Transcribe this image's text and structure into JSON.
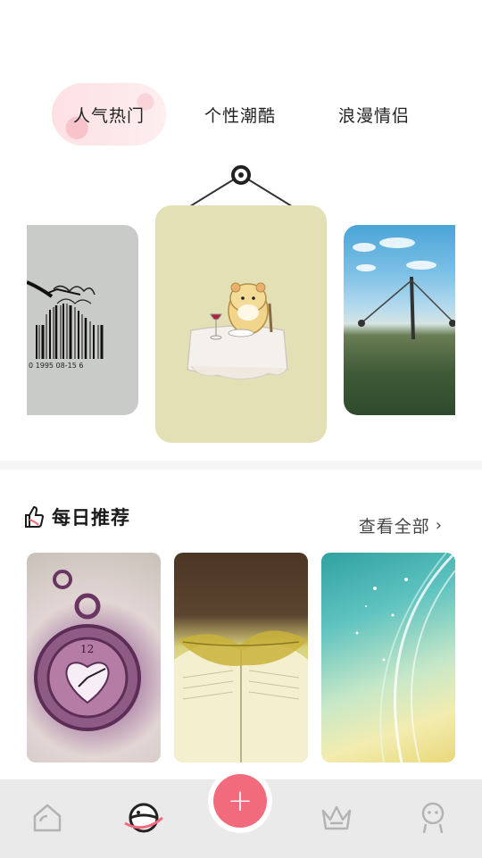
{
  "tabs": [
    {
      "label": "人气热门",
      "active": true
    },
    {
      "label": "个性潮酷",
      "active": false
    },
    {
      "label": "浪漫情侣",
      "active": false
    }
  ],
  "carousel": {
    "cards": [
      {
        "image": "barcode-fork-spaghetti",
        "barcode_text": "0  1995  08-15  6"
      },
      {
        "image": "hamster-dinner-table"
      },
      {
        "image": "landscape-swing-field"
      }
    ]
  },
  "daily": {
    "icon": "thumbs-up-icon",
    "title": "每日推荐",
    "view_all": "查看全部",
    "view_all_chevron": "›",
    "thumbnails": [
      {
        "image": "pocket-watch-flowers"
      },
      {
        "image": "open-book-leaf"
      },
      {
        "image": "teal-light-streaks"
      }
    ]
  },
  "bottom_nav": {
    "items": [
      {
        "icon": "home-icon",
        "active": false
      },
      {
        "icon": "planet-icon",
        "active": true
      },
      {
        "icon": "crown-icon",
        "active": false
      },
      {
        "icon": "profile-icon",
        "active": false
      }
    ],
    "fab_label": "+"
  },
  "colors": {
    "accent": "#f26b7d",
    "tab_active_bg": "#fde0e4",
    "card_center_bg": "#e3e0b5",
    "nav_bg": "#eaeaea"
  }
}
